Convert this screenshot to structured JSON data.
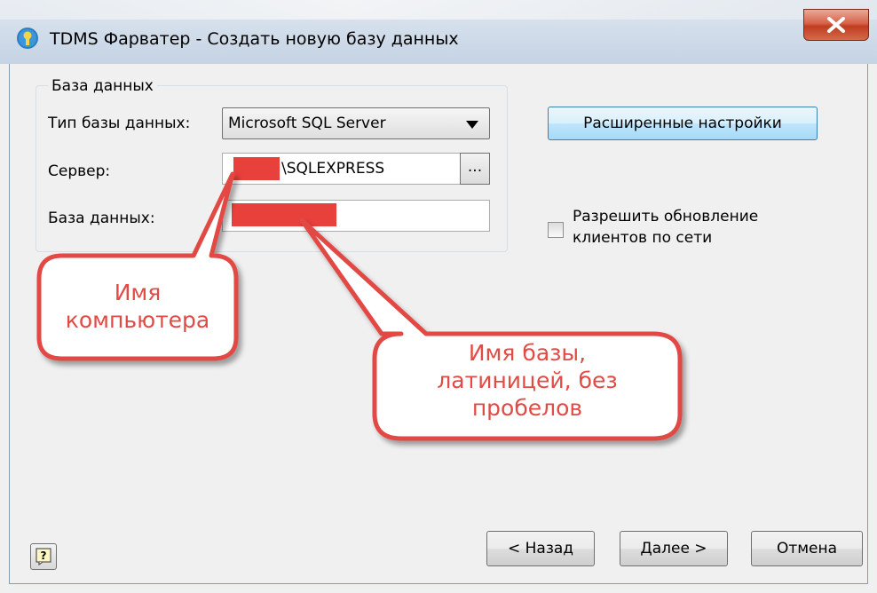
{
  "window": {
    "title": "TDMS Фарватер - Создать новую базу данных",
    "close_label": "x"
  },
  "database_group": {
    "legend": "База данных",
    "db_type_label": "Тип базы данных:",
    "db_type_value": "Microsoft SQL Server",
    "server_label": "Сервер:",
    "server_value": "\\SQLEXPRESS",
    "browse_label": "...",
    "db_name_label": "База данных:",
    "db_name_value": ""
  },
  "advanced_button": "Расширенные настройки",
  "allow_update": {
    "label_line1": "Разрешить обновление",
    "label_line2": "клиентов по сети",
    "checked": false
  },
  "footer": {
    "back": "< Назад",
    "next": "Далее >",
    "cancel": "Отмена",
    "help_icon": "help-icon"
  },
  "annotations": {
    "computer_name": [
      "Имя",
      "компьютера"
    ],
    "db_name_hint": [
      "Имя базы,",
      "латиницей, без",
      "пробелов"
    ]
  },
  "colors": {
    "callout_stroke": "#e24a45",
    "redaction": "#e8403b",
    "accent_button": "#bee6fd"
  }
}
